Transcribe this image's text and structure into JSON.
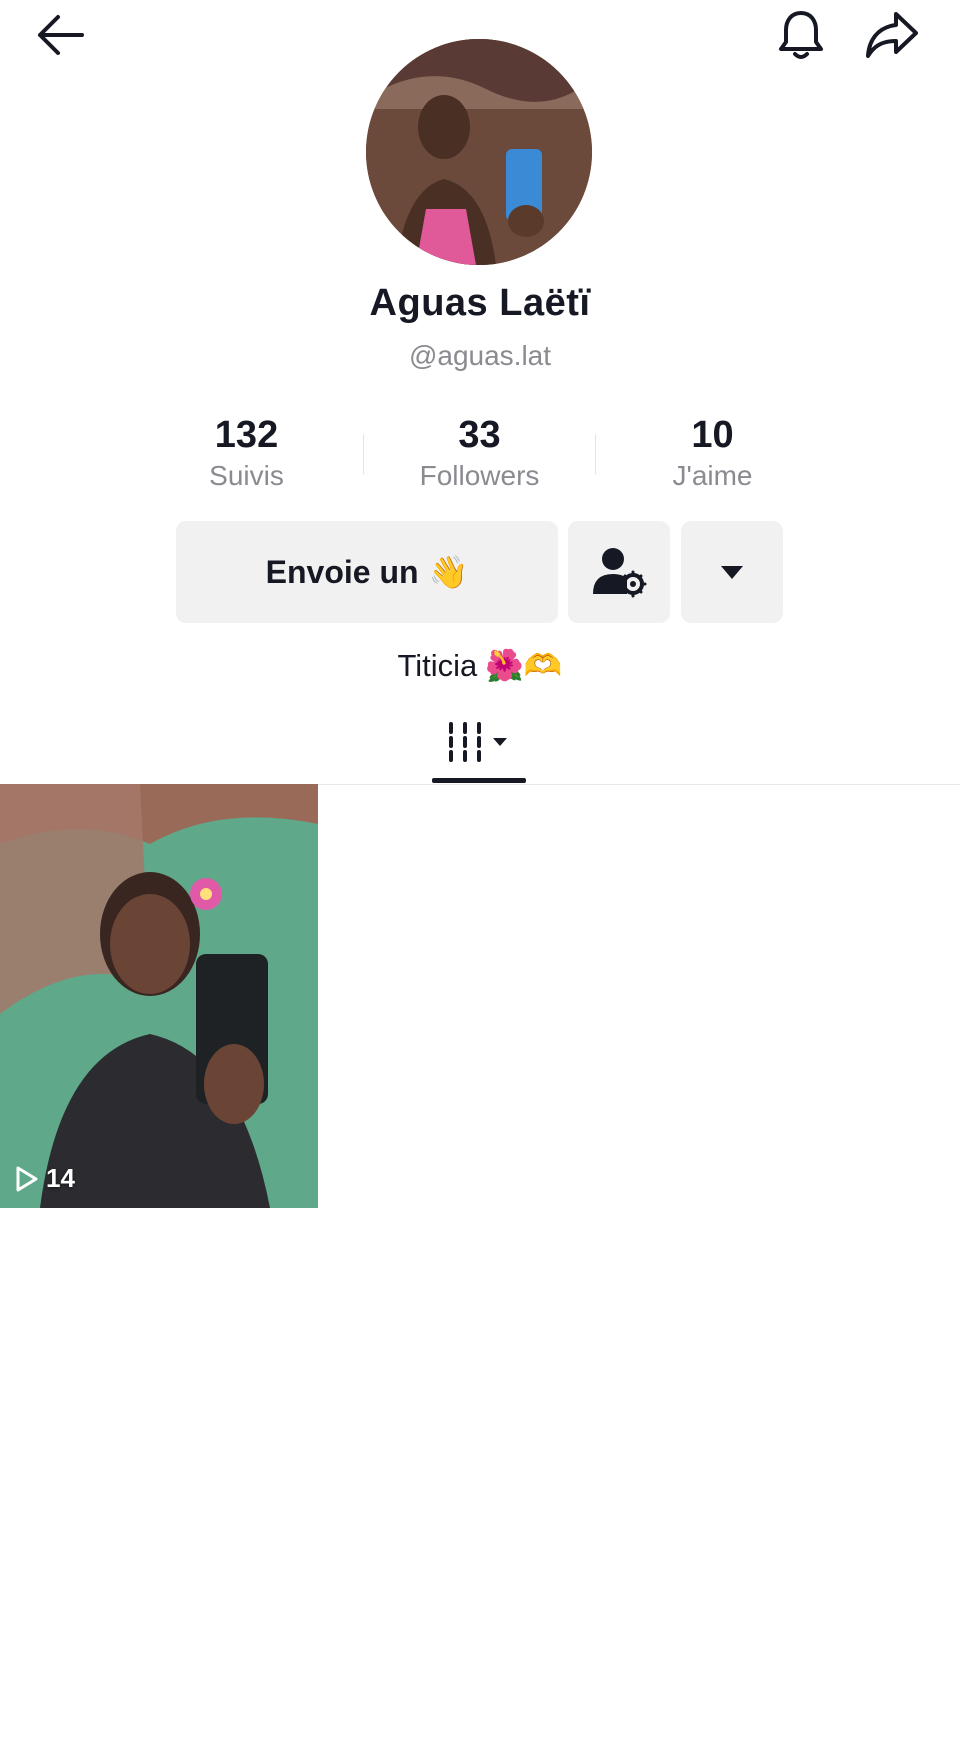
{
  "profile": {
    "display_name": "Aguas Laëtï",
    "handle": "@aguas.lat",
    "bio": "Titicia",
    "bio_emojis": "🌺🫶"
  },
  "stats": [
    {
      "value": "132",
      "label": "Suivis"
    },
    {
      "value": "33",
      "label": "Followers"
    },
    {
      "value": "10",
      "label": "J'aime"
    }
  ],
  "actions": {
    "message_label": "Envoie un",
    "message_emoji": "👋"
  },
  "videos": [
    {
      "plays": "14"
    }
  ],
  "icons": {
    "back": "back-arrow-icon",
    "notifications": "bell-icon",
    "share": "share-icon",
    "friends": "user-settings-icon",
    "more": "caret-down-icon",
    "videos_tab": "videos-grid-icon",
    "play": "play-icon"
  }
}
